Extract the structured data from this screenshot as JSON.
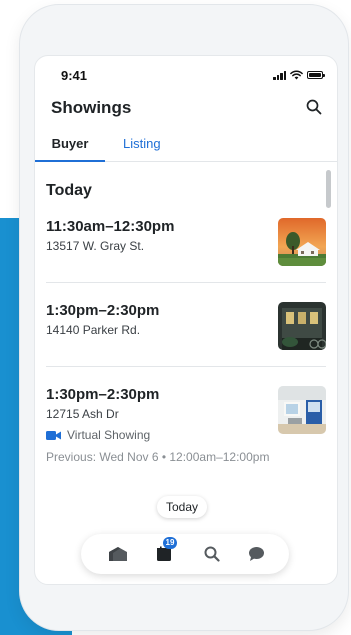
{
  "status_bar": {
    "time": "9:41"
  },
  "header": {
    "title": "Showings"
  },
  "tabs": [
    {
      "label": "Buyer",
      "active": true
    },
    {
      "label": "Listing",
      "active": false
    }
  ],
  "section": {
    "title": "Today"
  },
  "showings": [
    {
      "time": "11:30am–12:30pm",
      "address": "13517 W. Gray St.",
      "thumbnail": "house-exterior-sunset"
    },
    {
      "time": "1:30pm–2:30pm",
      "address": "14140 Parker Rd.",
      "thumbnail": "house-exterior-night"
    },
    {
      "time": "1:30pm–2:30pm",
      "address": "12715 Ash Dr",
      "thumbnail": "house-interior-room",
      "virtual_label": "Virtual Showing",
      "previous": "Previous: Wed Nov 6 • 12:00am–12:00pm"
    }
  ],
  "today_chip": "Today",
  "bottom_nav": {
    "items": [
      {
        "icon": "home-icon"
      },
      {
        "icon": "calendar-icon",
        "badge": "19"
      },
      {
        "icon": "search-icon"
      },
      {
        "icon": "chat-icon"
      }
    ]
  },
  "colors": {
    "accent": "#1f6fd6",
    "backdrop": "#1990d0"
  }
}
